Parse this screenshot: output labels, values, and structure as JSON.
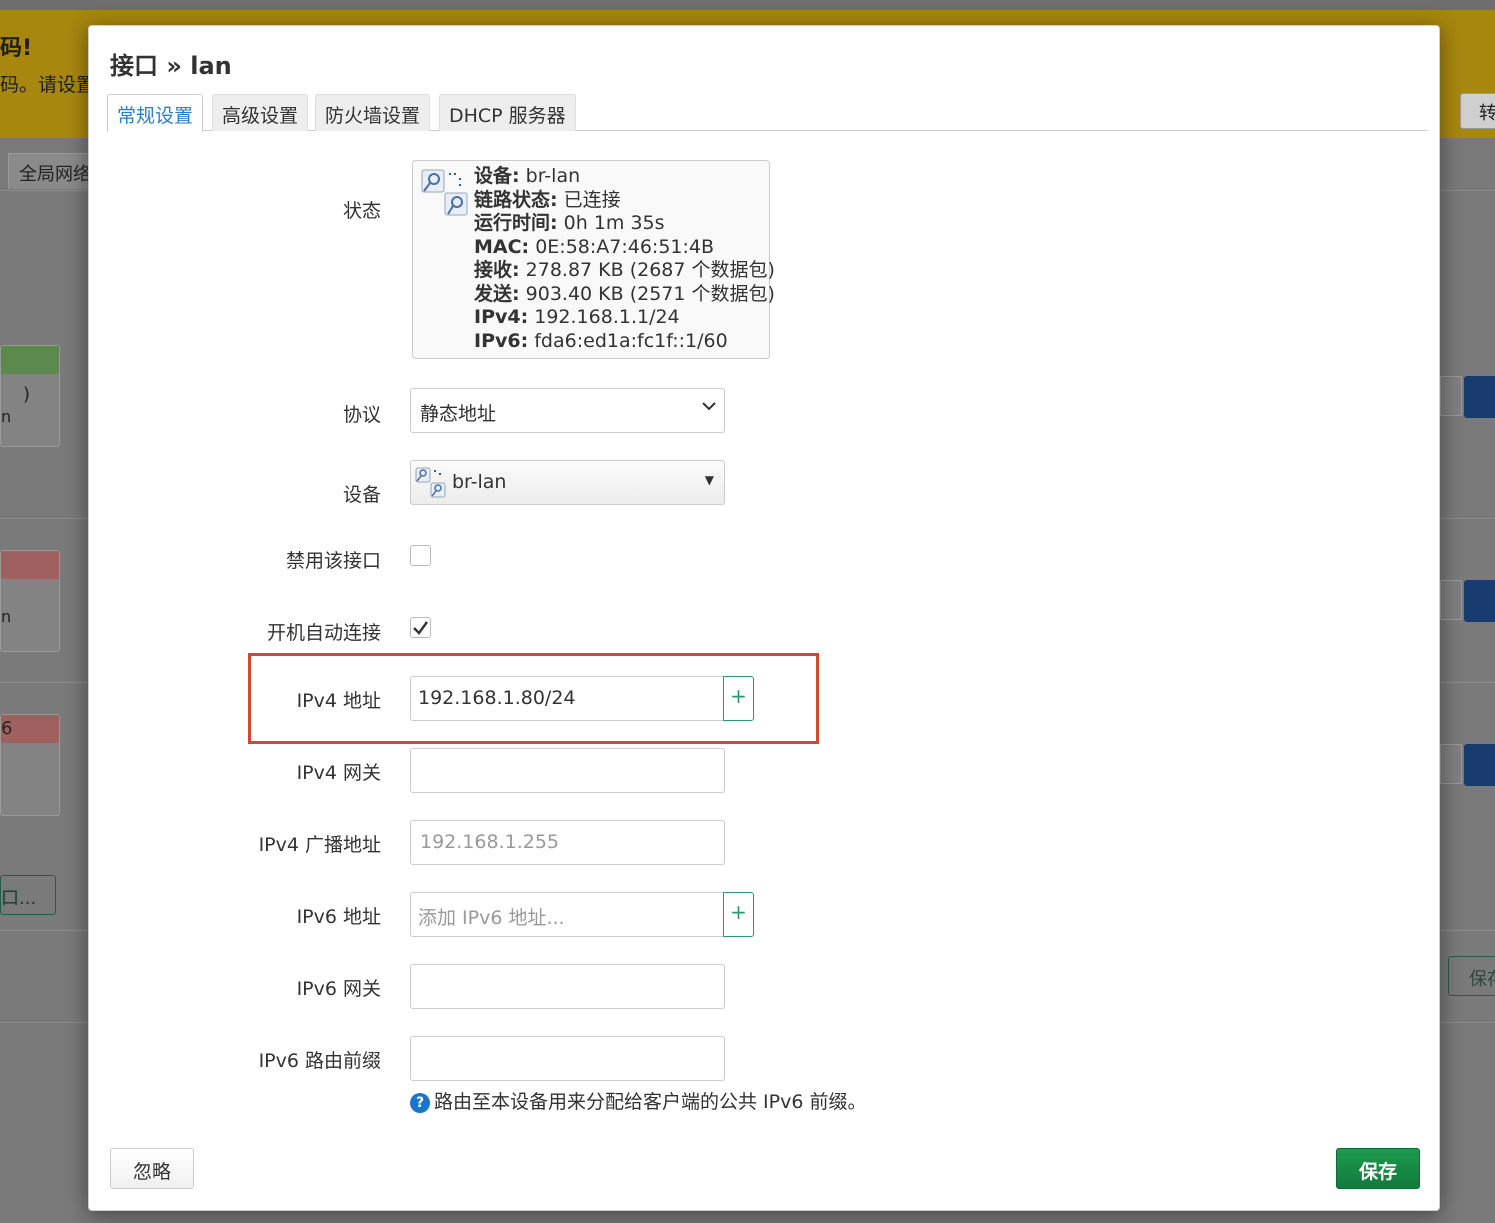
{
  "background": {
    "banner_title": "码!",
    "banner_text": "码。请设置",
    "banner_button": "转",
    "tab_label": "全局网络",
    "card_text_1": ")",
    "card_text_2": "n",
    "card_text_3": "n",
    "card_text_4": "6",
    "add_button": "口...",
    "save_button": "保存"
  },
  "modal": {
    "title": "接口 » lan",
    "tabs": [
      {
        "label": "常规设置",
        "active": true
      },
      {
        "label": "高级设置",
        "active": false
      },
      {
        "label": "防火墙设置",
        "active": false
      },
      {
        "label": "DHCP 服务器",
        "active": false
      }
    ],
    "status": {
      "label": "状态",
      "lines": [
        {
          "key": "设备:",
          "value": " br-lan"
        },
        {
          "key": "链路状态:",
          "value": " 已连接"
        },
        {
          "key": "运行时间:",
          "value": " 0h 1m 35s"
        },
        {
          "key": "MAC:",
          "value": " 0E:58:A7:46:51:4B"
        },
        {
          "key": "接收:",
          "value": " 278.87 KB (2687 个数据包)"
        },
        {
          "key": "发送:",
          "value": " 903.40 KB (2571 个数据包)"
        },
        {
          "key": "IPv4:",
          "value": " 192.168.1.1/24"
        },
        {
          "key": "IPv6:",
          "value": " fda6:ed1a:fc1f::1/60"
        }
      ]
    },
    "fields": {
      "protocol": {
        "label": "协议",
        "value": "静态地址"
      },
      "device": {
        "label": "设备",
        "value": "br-lan"
      },
      "disable": {
        "label": "禁用该接口",
        "checked": false
      },
      "autostart": {
        "label": "开机自动连接",
        "checked": true
      },
      "ipv4_addr": {
        "label": "IPv4 地址",
        "value": "192.168.1.80/24",
        "add": "+"
      },
      "ipv4_gw": {
        "label": "IPv4 网关",
        "value": ""
      },
      "ipv4_bcast": {
        "label": "IPv4 广播地址",
        "placeholder": "192.168.1.255"
      },
      "ipv6_addr": {
        "label": "IPv6 地址",
        "placeholder": "添加 IPv6 地址...",
        "add": "+"
      },
      "ipv6_gw": {
        "label": "IPv6 网关",
        "value": ""
      },
      "ipv6_prefix": {
        "label": "IPv6 路由前缀",
        "value": "",
        "help": "路由至本设备用来分配给客户端的公共 IPv6 前缀。",
        "help_icon": "?"
      }
    },
    "buttons": {
      "dismiss": "忽略",
      "save": "保存"
    }
  },
  "colors": {
    "accent_blue": "#2a7fc9",
    "save_green": "#117a3c",
    "add_green": "#2a9a6a",
    "highlight_red": "#d2472f",
    "banner_yellow": "#a8870f"
  }
}
